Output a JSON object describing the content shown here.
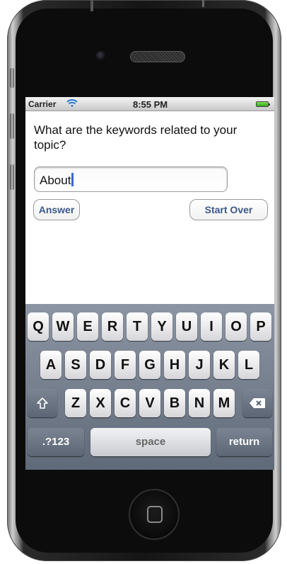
{
  "status_bar": {
    "carrier": "Carrier",
    "time": "8:55 PM",
    "wifi_icon": "wifi-icon",
    "battery_icon": "battery-icon"
  },
  "question": "What are the keywords related to your topic?",
  "input": {
    "value": "About",
    "placeholder": ""
  },
  "buttons": {
    "answer": "Answer",
    "start_over": "Start Over"
  },
  "keyboard": {
    "row1": [
      "Q",
      "W",
      "E",
      "R",
      "T",
      "Y",
      "U",
      "I",
      "O",
      "P"
    ],
    "row2": [
      "A",
      "S",
      "D",
      "F",
      "G",
      "H",
      "J",
      "K",
      "L"
    ],
    "row3": [
      "Z",
      "X",
      "C",
      "V",
      "B",
      "N",
      "M"
    ],
    "shift_icon": "shift-icon",
    "delete_icon": "delete-icon",
    "mode_key": ".?123",
    "space": "space",
    "return": "return"
  },
  "colors": {
    "button_text": "#3a5a8c",
    "cursor": "#3b66d8",
    "keyboard_bg": "#6f7a89"
  }
}
